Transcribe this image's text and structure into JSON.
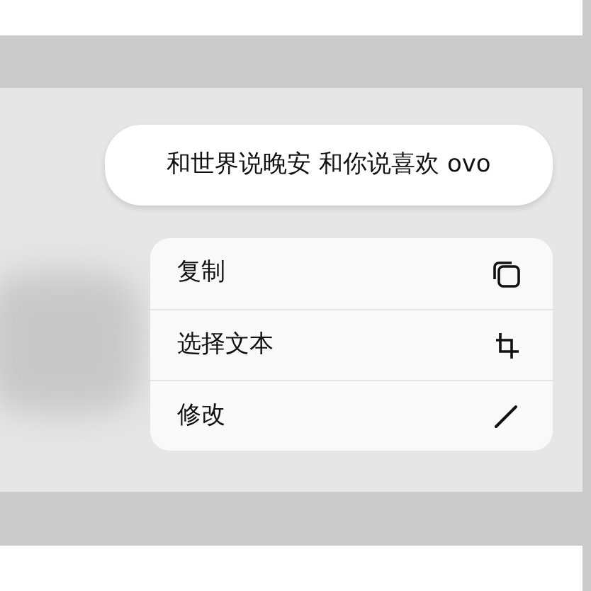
{
  "message": {
    "text": "和世界说晚安 和你说喜欢 ovo"
  },
  "context_menu": {
    "items": [
      {
        "label": "复制"
      },
      {
        "label": "选择文本"
      },
      {
        "label": "修改"
      }
    ]
  }
}
